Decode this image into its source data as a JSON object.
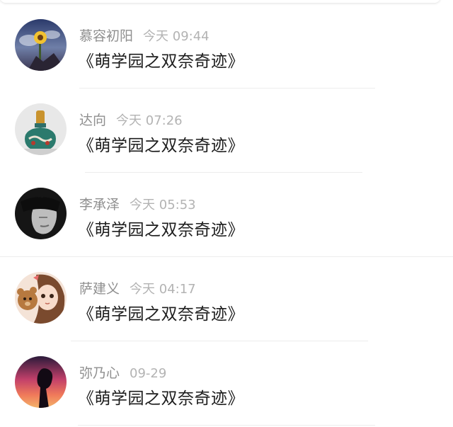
{
  "comments": [
    {
      "user": "慕容初阳",
      "time": "今天 09:44",
      "message": "《萌学园之双奈奇迹》",
      "avatar_icon": "sunflower-avatar"
    },
    {
      "user": "达向",
      "time": "今天 07:26",
      "message": "《萌学园之双奈奇迹》",
      "avatar_icon": "vase-avatar"
    },
    {
      "user": "李承泽",
      "time": "今天 05:53",
      "message": "《萌学园之双奈奇迹》",
      "avatar_icon": "masked-man-avatar"
    },
    {
      "user": "萨建义",
      "time": "今天 04:17",
      "message": "《萌学园之双奈奇迹》",
      "avatar_icon": "anime-girl-bear-avatar"
    },
    {
      "user": "弥乃心",
      "time": "09-29",
      "message": "《萌学园之双奈奇迹》",
      "avatar_icon": "sunset-silhouette-avatar"
    }
  ],
  "colors": {
    "username": "#8f8f8f",
    "timestamp": "#b3b3b3",
    "message": "#1d1d1d",
    "divider": "#ededed"
  }
}
